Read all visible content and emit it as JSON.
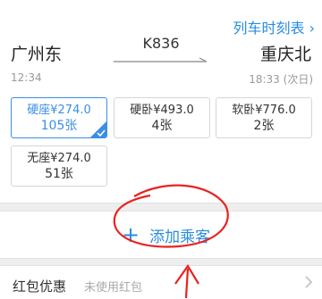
{
  "header": {
    "timetable_link": "列车时刻表 ›"
  },
  "train": {
    "from_station": "广州东",
    "to_station": "重庆北",
    "train_no": "K836",
    "dep_time": "12:34",
    "arr_time": "18:33 (次日)"
  },
  "seats": [
    {
      "price": "硬座¥274.0",
      "count": "105张",
      "selected": true
    },
    {
      "price": "硬卧¥493.0",
      "count": "4张",
      "selected": false
    },
    {
      "price": "软卧¥776.0",
      "count": "2张",
      "selected": false
    },
    {
      "price": "无座¥274.0",
      "count": "51张",
      "selected": false
    }
  ],
  "passenger": {
    "add_label": "添加乘客"
  },
  "coupon": {
    "label": "红包优惠",
    "value": "未使用红包"
  },
  "colors": {
    "accent": "#2a8cdf",
    "selected_border": "#3a8ee6",
    "annotation": "#e8231f"
  },
  "icons": {
    "add": "plus-icon",
    "next": "chevron-right-icon",
    "selected": "check-icon"
  }
}
